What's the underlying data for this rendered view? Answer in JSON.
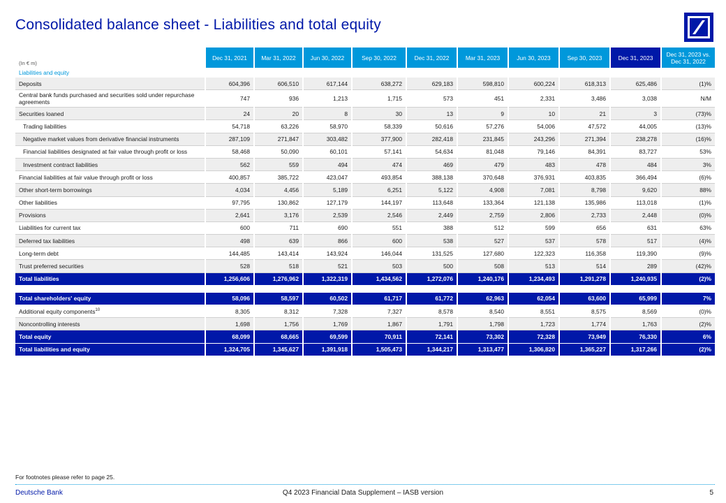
{
  "title": "Consolidated balance sheet - Liabilities and total equity",
  "logo": "deutsche-bank-logo",
  "unit": "(In € m)",
  "columns": [
    "Dec 31, 2021",
    "Mar 31, 2022",
    "Jun 30, 2022",
    "Sep 30, 2022",
    "Dec 31, 2022",
    "Mar 31, 2023",
    "Jun 30, 2023",
    "Sep 30, 2023",
    "Dec 31, 2023",
    "Dec 31, 2023 vs. Dec 31, 2022"
  ],
  "section": "Liabilities and equity",
  "rows": [
    {
      "label": "Deposits",
      "values": [
        "604,396",
        "606,510",
        "617,144",
        "638,272",
        "629,183",
        "598,810",
        "600,224",
        "618,313",
        "625,486",
        "(1)%"
      ],
      "style": "shade"
    },
    {
      "label": "Central bank funds purchased and securities sold under repurchase agreements",
      "values": [
        "747",
        "936",
        "1,213",
        "1,715",
        "573",
        "451",
        "2,331",
        "3,486",
        "3,038",
        "N/M"
      ],
      "style": "wrap"
    },
    {
      "label": "Securities loaned",
      "values": [
        "24",
        "20",
        "8",
        "30",
        "13",
        "9",
        "10",
        "21",
        "3",
        "(73)%"
      ],
      "style": "shade"
    },
    {
      "label": "Trading liabilities",
      "values": [
        "54,718",
        "63,226",
        "58,970",
        "58,339",
        "50,616",
        "57,276",
        "54,006",
        "47,572",
        "44,005",
        "(13)%"
      ],
      "style": "indent"
    },
    {
      "label": "Negative market values from derivative financial instruments",
      "values": [
        "287,109",
        "271,847",
        "303,482",
        "377,900",
        "282,418",
        "231,845",
        "243,296",
        "271,394",
        "238,278",
        "(16)%"
      ],
      "style": "indent-shade"
    },
    {
      "label": "Financial liabilities designated at fair value through profit or loss",
      "values": [
        "58,468",
        "50,090",
        "60,101",
        "57,141",
        "54,634",
        "81,048",
        "79,146",
        "84,391",
        "83,727",
        "53%"
      ],
      "style": "indent"
    },
    {
      "label": "Investment contract liabilities",
      "values": [
        "562",
        "559",
        "494",
        "474",
        "469",
        "479",
        "483",
        "478",
        "484",
        "3%"
      ],
      "style": "indent-shade"
    },
    {
      "label": "Financial liabilities at fair value through profit or loss",
      "values": [
        "400,857",
        "385,722",
        "423,047",
        "493,854",
        "388,138",
        "370,648",
        "376,931",
        "403,835",
        "366,494",
        "(6)%"
      ],
      "style": ""
    },
    {
      "label": "Other short-term borrowings",
      "values": [
        "4,034",
        "4,456",
        "5,189",
        "6,251",
        "5,122",
        "4,908",
        "7,081",
        "8,798",
        "9,620",
        "88%"
      ],
      "style": "shade"
    },
    {
      "label": "Other liabilities",
      "values": [
        "97,795",
        "130,862",
        "127,179",
        "144,197",
        "113,648",
        "133,364",
        "121,138",
        "135,986",
        "113,018",
        "(1)%"
      ],
      "style": ""
    },
    {
      "label": "Provisions",
      "values": [
        "2,641",
        "3,176",
        "2,539",
        "2,546",
        "2,449",
        "2,759",
        "2,806",
        "2,733",
        "2,448",
        "(0)%"
      ],
      "style": "shade"
    },
    {
      "label": "Liabilities for current tax",
      "values": [
        "600",
        "711",
        "690",
        "551",
        "388",
        "512",
        "599",
        "656",
        "631",
        "63%"
      ],
      "style": ""
    },
    {
      "label": "Deferred tax liabilities",
      "values": [
        "498",
        "639",
        "866",
        "600",
        "538",
        "527",
        "537",
        "578",
        "517",
        "(4)%"
      ],
      "style": "shade"
    },
    {
      "label": "Long-term debt",
      "values": [
        "144,485",
        "143,414",
        "143,924",
        "146,044",
        "131,525",
        "127,680",
        "122,323",
        "116,358",
        "119,390",
        "(9)%"
      ],
      "style": ""
    },
    {
      "label": "Trust preferred securities",
      "values": [
        "528",
        "518",
        "521",
        "503",
        "500",
        "508",
        "513",
        "514",
        "289",
        "(42)%"
      ],
      "style": "shade"
    },
    {
      "label": "Total liabilities",
      "values": [
        "1,256,606",
        "1,276,962",
        "1,322,319",
        "1,434,562",
        "1,272,076",
        "1,240,176",
        "1,234,493",
        "1,291,278",
        "1,240,935",
        "(2)%"
      ],
      "style": "total"
    }
  ],
  "equity_rows": [
    {
      "label": "Total shareholders' equity",
      "values": [
        "58,096",
        "58,597",
        "60,502",
        "61,717",
        "61,772",
        "62,963",
        "62,054",
        "63,600",
        "65,999",
        "7%"
      ],
      "style": "total"
    },
    {
      "label": "Additional equity components",
      "sup": "10",
      "values": [
        "8,305",
        "8,312",
        "7,328",
        "7,327",
        "8,578",
        "8,540",
        "8,551",
        "8,575",
        "8,569",
        "(0)%"
      ],
      "style": ""
    },
    {
      "label": "Noncontrolling interests",
      "values": [
        "1,698",
        "1,756",
        "1,769",
        "1,867",
        "1,791",
        "1,798",
        "1,723",
        "1,774",
        "1,763",
        "(2)%"
      ],
      "style": "shade"
    },
    {
      "label": "Total equity",
      "values": [
        "68,099",
        "68,665",
        "69,599",
        "70,911",
        "72,141",
        "73,302",
        "72,328",
        "73,949",
        "76,330",
        "6%"
      ],
      "style": "total"
    },
    {
      "label": "Total liabilities and equity",
      "values": [
        "1,324,705",
        "1,345,627",
        "1,391,918",
        "1,505,473",
        "1,344,217",
        "1,313,477",
        "1,306,820",
        "1,365,227",
        "1,317,266",
        "(2)%"
      ],
      "style": "total"
    }
  ],
  "footnote": "For footnotes please refer to page 25.",
  "footer": {
    "brand": "Deutsche Bank",
    "center": "Q4 2023 Financial Data Supplement – IASB version",
    "page": "5"
  }
}
